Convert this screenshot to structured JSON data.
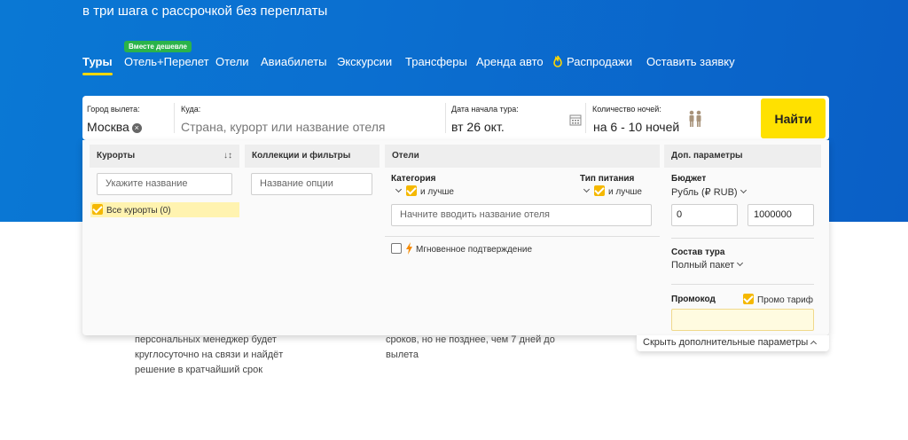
{
  "hero": {
    "tagline": "в три шага с рассрочкой без переплаты"
  },
  "nav": {
    "badge": "Вместе дешевле",
    "tabs": [
      {
        "label": "Туры"
      },
      {
        "label": "Отель+Перелет"
      },
      {
        "label": "Отели"
      },
      {
        "label": "Авиабилеты"
      },
      {
        "label": "Экскурсии"
      },
      {
        "label": "Трансферы"
      },
      {
        "label": "Аренда авто"
      },
      {
        "label": "Распродажи"
      },
      {
        "label": "Оставить заявку"
      }
    ]
  },
  "search": {
    "city_label": "Город вылета:",
    "city_value": "Москва",
    "dest_label": "Куда:",
    "dest_placeholder": "Страна, курорт или название отеля",
    "date_label": "Дата начала тура:",
    "date_value": "вт 26 окт.",
    "nights_label": "Количество ночей:",
    "nights_value": "на 6 - 10 ночей",
    "find_label": "Найти"
  },
  "filters": {
    "resorts": {
      "title": "Курорты",
      "placeholder": "Укажите название",
      "all_label": "Все курорты (0)"
    },
    "collections": {
      "title": "Коллекции и фильтры",
      "placeholder": "Название опции"
    },
    "hotels": {
      "title": "Отели",
      "category_label": "Категория",
      "and_better_1": "и лучше",
      "meal_label": "Тип питания",
      "and_better_2": "и лучше",
      "hotel_placeholder": "Начните вводить название отеля",
      "instant_label": "Мгновенное подтверждение"
    },
    "extra": {
      "title": "Доп. параметры",
      "budget_label": "Бюджет",
      "currency": "Рубль (₽ RUB)",
      "min": "0",
      "max": "1000000",
      "composition_label": "Состав тура",
      "composition_value": "Полный пакет",
      "promo_label": "Промокод",
      "promo_tariff_label": "Промо тариф"
    },
    "collapse_label": "Скрыть дополнительные параметры"
  },
  "below": {
    "left": [
      "персональных менеджер будет",
      "круглосуточно на связи и найдёт",
      "решение в кратчайший срок"
    ],
    "right": [
      "сроков, но не позднее, чем 7 дней до",
      "вылета"
    ]
  }
}
